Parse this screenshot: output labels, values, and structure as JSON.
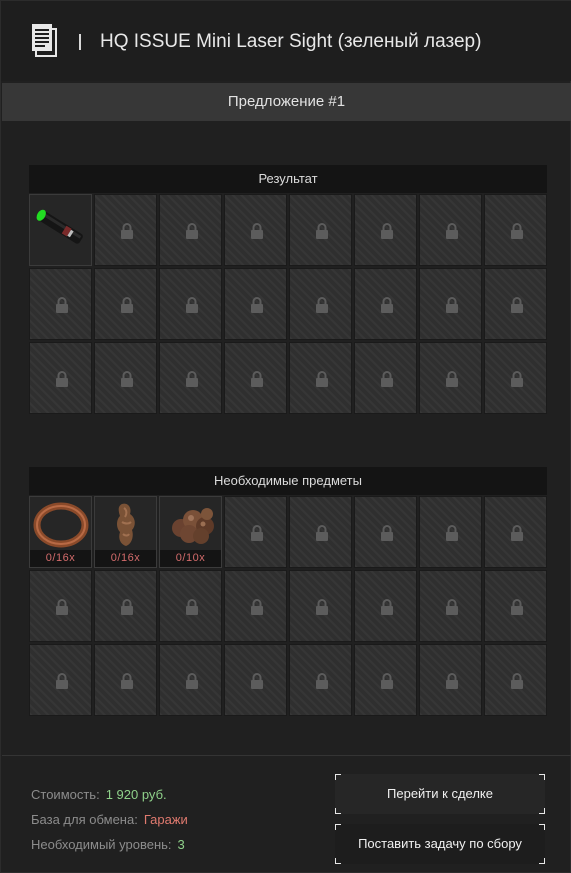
{
  "header": {
    "title": "HQ ISSUE Mini Laser Sight (зеленый лазер)",
    "icon": "document-icon"
  },
  "offer": {
    "label": "Предложение #1"
  },
  "result": {
    "title": "Результат",
    "items": [
      {
        "name": "laser-sight-green",
        "icon": "laser-sight-icon",
        "accent": "#22dd22"
      }
    ],
    "locked_icon": "lock-icon"
  },
  "required": {
    "title": "Необходимые предметы",
    "items": [
      {
        "icon": "copper-coil-icon",
        "count": "0/16x"
      },
      {
        "icon": "rusty-statue-icon",
        "count": "0/16x"
      },
      {
        "icon": "rock-cluster-icon",
        "count": "0/10x"
      }
    ]
  },
  "footer": {
    "cost_label": "Стоимость:",
    "cost_value": "1 920 руб.",
    "base_label": "База для обмена:",
    "base_value": "Гаражи",
    "level_label": "Необходимый уровень:",
    "level_value": "3",
    "btn_deal": "Перейти к сделке",
    "btn_task": "Поставить задачу по сбору"
  },
  "colors": {
    "accent_green": "#8fd18a",
    "accent_red": "#e07a6f",
    "count_red": "#d36b6b"
  }
}
